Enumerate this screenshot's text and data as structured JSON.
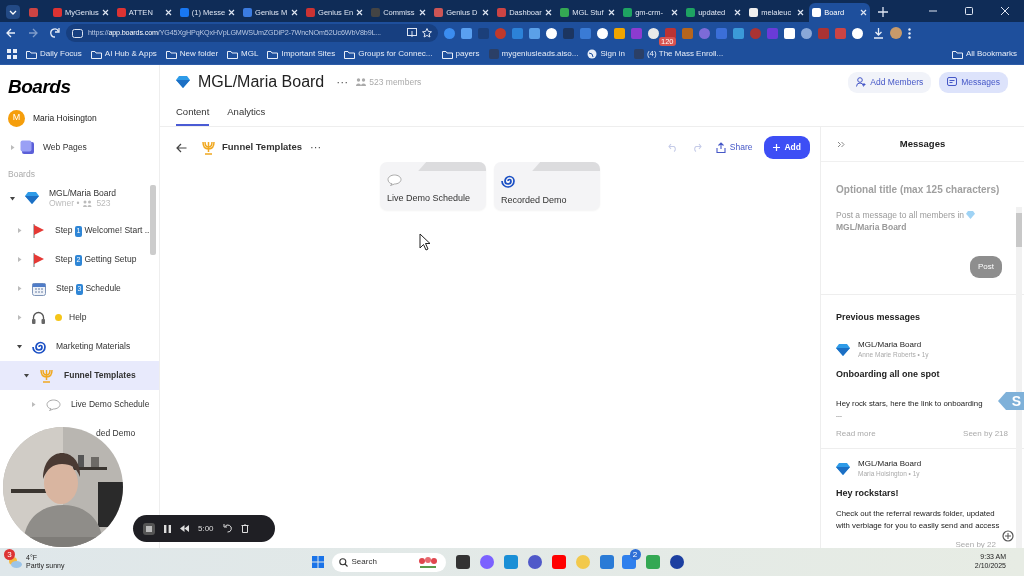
{
  "browser": {
    "tabs": [
      {
        "kind": "pinned",
        "selected": false
      },
      {
        "title": "MyGenius",
        "kind": "page",
        "selected": false
      },
      {
        "title": "ATTEN",
        "kind": "page",
        "selected": false
      },
      {
        "title": "(1) Messe",
        "kind": "page",
        "selected": false
      },
      {
        "title": "Genius M",
        "kind": "page",
        "selected": false
      },
      {
        "title": "Genius En",
        "kind": "page",
        "selected": false
      },
      {
        "title": "Commiss",
        "kind": "page",
        "selected": false
      },
      {
        "title": "Genius D",
        "kind": "page",
        "selected": false
      },
      {
        "title": "Dashboar",
        "kind": "page",
        "selected": false
      },
      {
        "title": "MGL Stuf",
        "kind": "page",
        "selected": false
      },
      {
        "title": "gm-crm-",
        "kind": "page",
        "selected": false
      },
      {
        "title": "updated",
        "kind": "page",
        "selected": false
      },
      {
        "title": "melaleuc",
        "kind": "page",
        "selected": false
      },
      {
        "title": "Board",
        "kind": "page",
        "selected": true
      }
    ],
    "url": "https://**app.boards.com**/YG45XgHPqKQxHVpLGMWSUmZGDiP2-7WncNOm52Uc6WbV8b9L...",
    "extension_badge": "120",
    "bookmarks": [
      {
        "label": "Daily Focus",
        "kind": "folder"
      },
      {
        "label": "AI Hub & Apps",
        "kind": "folder"
      },
      {
        "label": "New folder",
        "kind": "folder"
      },
      {
        "label": "MGL",
        "kind": "folder"
      },
      {
        "label": "Important Sites",
        "kind": "folder"
      },
      {
        "label": "Groups for Connec...",
        "kind": "folder"
      },
      {
        "label": "payers",
        "kind": "folder"
      },
      {
        "label": "mygeniusleads.aiso...",
        "kind": "site"
      },
      {
        "label": "Sign in",
        "kind": "globe"
      },
      {
        "label": "(4) The Mass Enroll...",
        "kind": "site"
      }
    ],
    "all_bookmarks": "All Bookmarks"
  },
  "sidebar": {
    "logo": "Boards",
    "user": {
      "initial": "M",
      "name": "Maria Hoisington"
    },
    "web_pages": "Web Pages",
    "section": "Boards",
    "tree": [
      {
        "kind": "diamond",
        "label": "MGL/Maria Board",
        "meta": "Owner •",
        "count": "523",
        "expanded": true,
        "selected": false,
        "children": [
          {
            "kind": "flag",
            "step": "Step",
            "number": "1",
            "label": "Welcome! Start ...",
            "expanded": false,
            "selected": false
          },
          {
            "kind": "flag",
            "step": "Step",
            "number": "2",
            "label": "Getting Setup",
            "expanded": false,
            "selected": false
          },
          {
            "kind": "calendar",
            "step": "Step",
            "number": "3",
            "label": "Schedule",
            "expanded": false,
            "selected": false
          },
          {
            "kind": "headphones",
            "sun": true,
            "label": "Help",
            "expanded": false,
            "selected": false
          },
          {
            "kind": "spiral",
            "label": "Marketing Materials",
            "expanded": true,
            "selected": false,
            "children": [
              {
                "kind": "funnel",
                "label": "Funnel Templates",
                "expanded": true,
                "selected": true,
                "children": [
                  {
                    "kind": "bubble",
                    "label": "Live Demo Schedule",
                    "expanded": false,
                    "selected": false
                  },
                  {
                    "kind": "covered",
                    "label": "ded Demo",
                    "expanded": false,
                    "selected": false
                  }
                ]
              }
            ]
          }
        ]
      }
    ]
  },
  "header": {
    "title": "MGL/Maria Board",
    "more": "···",
    "members": "523 members",
    "buttons": [
      {
        "label": "Add Members",
        "kind": "add-members",
        "selected": false
      },
      {
        "label": "Messages",
        "kind": "messages",
        "selected": true
      }
    ]
  },
  "tabs": [
    {
      "label": "Content",
      "selected": true
    },
    {
      "label": "Analytics",
      "selected": false
    }
  ],
  "toolbar": {
    "title": "Funnel Templates",
    "more": "···",
    "undo_disabled": true,
    "redo_disabled": true,
    "share": "Share",
    "add": "Add"
  },
  "cards": [
    {
      "kind": "bubble",
      "label": "Live Demo Schedule"
    },
    {
      "kind": "spiral",
      "label": "Recorded Demo"
    }
  ],
  "messages": {
    "title": "Messages",
    "title_placeholder": "Optional title (max 125 characters)",
    "body_placeholder": "Post a message to all members in",
    "body_board": "MGL/Maria Board",
    "post": "Post",
    "post_disabled": true,
    "previous": "Previous messages",
    "items": [
      {
        "board": "MGL/Maria Board",
        "author": "Anne Marie Roberts • 1y",
        "title": "Onboarding all one spot",
        "body": "Hey rock stars, here the link to onboarding",
        "ellipsis": "...",
        "read_more": "Read more",
        "seen": "Seen by 218"
      },
      {
        "board": "MGL/Maria Board",
        "author": "Maria Hoisington • 1y",
        "title": "Hey rockstars!",
        "body": "Check out the referral rewards folder, updated with verbiage for you to easily send and access",
        "seen": "Seen by 22"
      }
    ]
  },
  "side_tag": "S",
  "recorder": {
    "time": "5:00"
  },
  "taskbar": {
    "weather_badge": "3",
    "temperature": "4°F",
    "weather": "Partly sunny",
    "search": "Search",
    "todo_badge": "2",
    "time": "9:33 AM",
    "date": "2/10/2025"
  }
}
